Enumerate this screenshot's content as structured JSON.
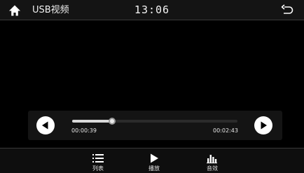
{
  "header": {
    "title": "USB视频",
    "clock": "13:06",
    "home_icon": "home-icon",
    "back_icon": "return-icon"
  },
  "player": {
    "current_time": "00:00:39",
    "total_time": "00:02:43",
    "progress": 0.24,
    "prev_icon": "previous-track-icon",
    "next_icon": "next-track-icon"
  },
  "bottom_tabs": [
    {
      "label": "列表",
      "icon": "list-icon"
    },
    {
      "label": "播放",
      "icon": "play-icon"
    },
    {
      "label": "音效",
      "icon": "equalizer-icon"
    }
  ],
  "colors": {
    "background": "#000000",
    "bar": "#141414",
    "accent": "#ffffff"
  }
}
